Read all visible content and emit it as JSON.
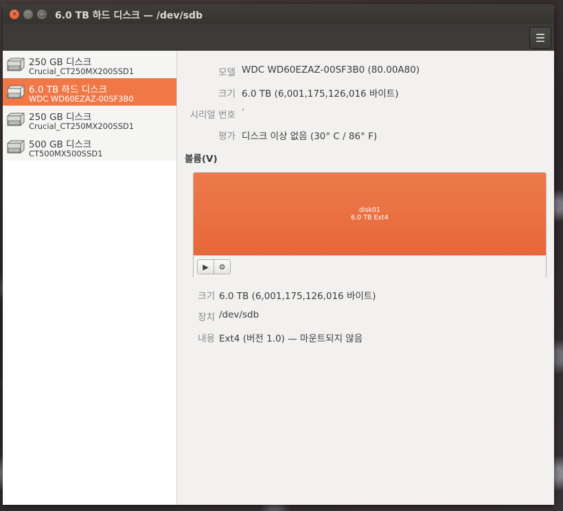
{
  "window": {
    "title": "6.0 TB 하드 디스크 — /dev/sdb",
    "controls": {
      "close_glyph": "×",
      "minimize_glyph": "–",
      "maximize_glyph": "□"
    },
    "menu_glyph": "☰"
  },
  "disks": [
    {
      "name": "250 GB 디스크",
      "model": "Crucial_CT250MX200SSD1",
      "selected": false
    },
    {
      "name": "6.0 TB 하드 디스크",
      "model": "WDC WD60EZAZ-00SF3B0",
      "selected": true
    },
    {
      "name": "250 GB 디스크",
      "model": "Crucial_CT250MX200SSD1",
      "selected": false
    },
    {
      "name": "500 GB 디스크",
      "model": "CT500MX500SSD1",
      "selected": false
    }
  ],
  "drive_info": {
    "model_label": "모델",
    "model_value": "WDC WD60EZAZ-00SF3B0 (80.00A80)",
    "size_label": "크기",
    "size_value": "6.0 TB (6,001,175,126,016 바이트)",
    "serial_label": "시리얼 번호",
    "serial_value": "'",
    "assessment_label": "평가",
    "assessment_value": "디스크 이상 없음 (30° C / 86° F)"
  },
  "volumes": {
    "heading": "볼륨(V)",
    "partition_name": "disk01",
    "partition_desc": "6.0 TB Ext4",
    "play_glyph": "▶",
    "gear_glyph": "⚙"
  },
  "partition_info": {
    "size_label": "크기",
    "size_value": "6.0 TB (6,001,175,126,016 바이트)",
    "device_label": "장치",
    "device_value": "/dev/sdb",
    "contents_label": "내용",
    "contents_value": "Ext4 (버전 1.0) — 마운트되지 않음"
  },
  "colors": {
    "accent": "#f07746",
    "titlebar": "#3e3d39",
    "close": "#de4a21"
  }
}
